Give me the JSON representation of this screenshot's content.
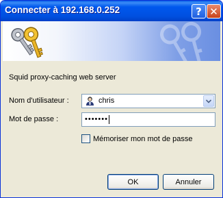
{
  "window": {
    "title": "Connecter à 192.168.0.252",
    "help_glyph": "?",
    "close_glyph": "✕"
  },
  "banner": {
    "icon": "keys-icon",
    "watermark_icon": "keys-watermark-icon"
  },
  "server_text": "Squid proxy-caching web server",
  "username": {
    "label": "Nom d'utilisateur :",
    "value": "chris",
    "icon": "user-icon"
  },
  "password": {
    "label": "Mot de passe :",
    "masked_value": "•••••••"
  },
  "remember": {
    "label": "Mémoriser mon mot de passe",
    "checked": false
  },
  "buttons": {
    "ok": "OK",
    "cancel": "Annuler"
  },
  "colors": {
    "titlebar": "#0058ee",
    "dialog_bg": "#ece9d8",
    "input_border": "#7f9db9"
  }
}
